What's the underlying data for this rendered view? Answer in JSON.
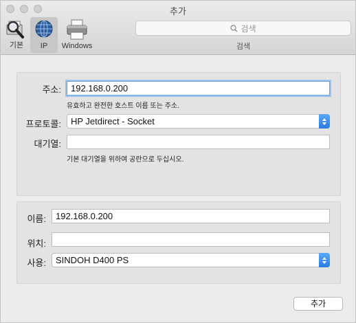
{
  "window": {
    "title": "추가"
  },
  "toolbar": {
    "items": [
      {
        "label": "기본",
        "icon": "magnifier-icon"
      },
      {
        "label": "IP",
        "icon": "globe-icon",
        "selected": true
      },
      {
        "label": "Windows",
        "icon": "printer-icon"
      }
    ],
    "search": {
      "placeholder": "검색",
      "caption": "검색"
    }
  },
  "connection": {
    "address_label": "주소:",
    "address_value": "192.168.0.200",
    "address_hint": "유효하고 완전한 호스트 이름 또는 주소.",
    "protocol_label": "프로토콜:",
    "protocol_value": "HP Jetdirect - Socket",
    "queue_label": "대기열:",
    "queue_value": "",
    "queue_hint": "기본 대기열을 위하여 공란으로 두십시오."
  },
  "printer": {
    "name_label": "이름:",
    "name_value": "192.168.0.200",
    "location_label": "위치:",
    "location_value": "",
    "use_label": "사용:",
    "use_value": "SINDOH D400 PS"
  },
  "actions": {
    "add_label": "추가"
  },
  "colors": {
    "accent": "#2a7ce3",
    "focus_ring": "#9cc3f0"
  }
}
